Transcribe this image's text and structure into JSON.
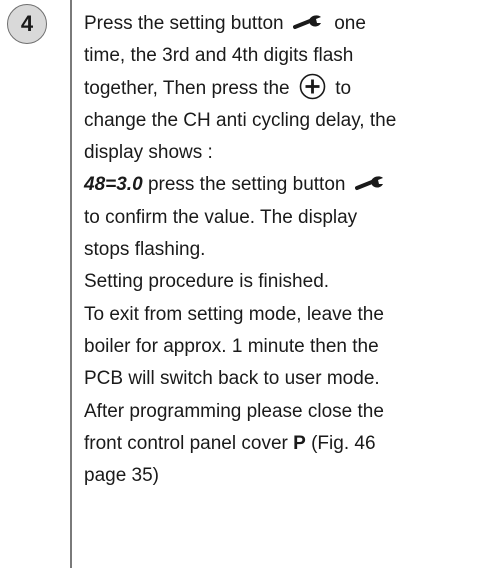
{
  "step": {
    "number": "4"
  },
  "text": {
    "l1a": "Press the setting button",
    "l1b": "one",
    "l2": "time, the 3rd and 4th digits flash",
    "l3a": "together, Then press the",
    "l3b": "to",
    "l4": "change the CH anti cycling delay, the",
    "l5": "display shows :",
    "l6_value": "48=3.0",
    "l6b": "press the setting button",
    "l7": "to confirm the value. The display",
    "l8": "stops flashing.",
    "l9": "Setting procedure is finished.",
    "l10": "To exit from setting mode, leave the",
    "l11": "boiler for approx. 1 minute then the",
    "l12": "PCB will switch back to user mode.",
    "l13": "After programming please close the",
    "l14a": "front control panel cover",
    "l14_bold": "P",
    "l14b": "(Fig. 46",
    "l15": "page 35)"
  },
  "icons": [
    "wrench-icon",
    "plus-button-icon"
  ]
}
